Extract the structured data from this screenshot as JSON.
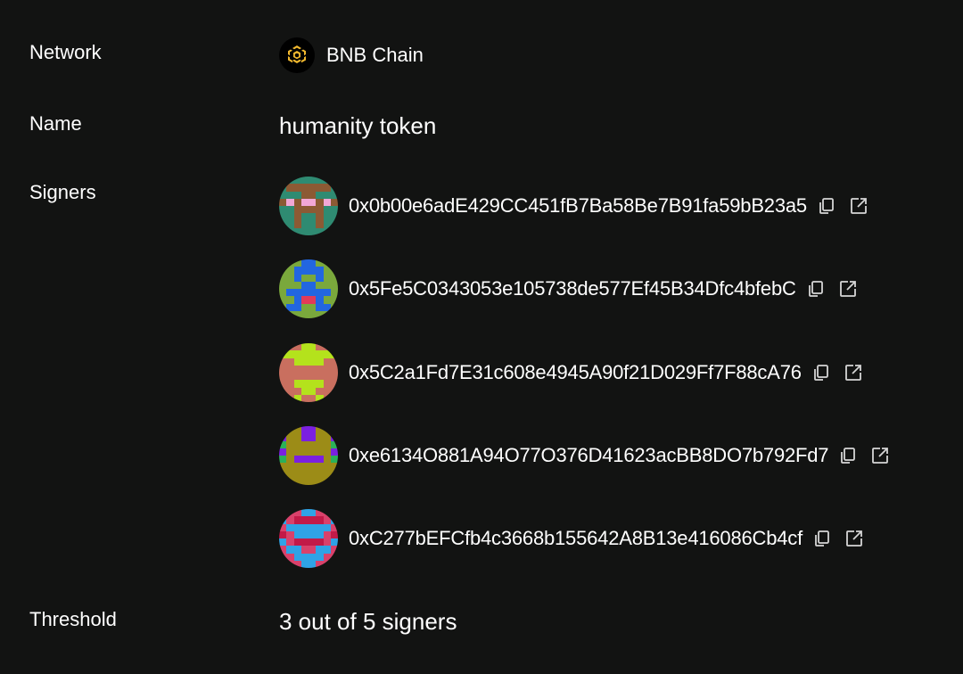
{
  "labels": {
    "network": "Network",
    "name": "Name",
    "signers": "Signers",
    "threshold": "Threshold"
  },
  "network": {
    "name": "BNB Chain",
    "icon": "bnb-chain-icon",
    "logo_color": "#F3BA2F"
  },
  "safe_name": "humanity token",
  "signers": [
    {
      "address": "0x0b00e6adE429CC451fB7Ba58Be7B91fa59bB23a5",
      "avatar_colors": [
        "#2f8b72",
        "#8c5a34",
        "#f2a7d6"
      ],
      "avatar_pattern": [
        "00000000",
        "01111110",
        "00011000",
        "12122121",
        "00111100",
        "00100100",
        "00100100",
        "00000000"
      ]
    },
    {
      "address": "0x5Fe5C0343053e105738de577Ef45B34Dfc4bfebC",
      "avatar_colors": [
        "#7aa83c",
        "#2266e0",
        "#e23a59"
      ],
      "avatar_pattern": [
        "00011000",
        "00111100",
        "00100100",
        "00011000",
        "01111110",
        "00122100",
        "01100110",
        "00000000"
      ]
    },
    {
      "address": "0x5C2a1Fd7E31c608e4945A90f21D029Ff7F88cA76",
      "avatar_colors": [
        "#c96f5f",
        "#b4e21c",
        "#d65a48"
      ],
      "avatar_pattern": [
        "00011000",
        "11111111",
        "00111100",
        "00000000",
        "00000000",
        "00111100",
        "00011000",
        "00100100"
      ]
    },
    {
      "address": "0xe6134O881A94O77O376D41623acBB8DO7b792Fd7",
      "avatar_colors": [
        "#9c8c17",
        "#7b20e0",
        "#2bb159"
      ],
      "avatar_pattern": [
        "00011000",
        "10011001",
        "20000002",
        "10000001",
        "20111102",
        "00000000",
        "00000000",
        "00000000"
      ]
    },
    {
      "address": "0xC277bEFCfb4c3668b155642A8B13e416086Cb4cf",
      "avatar_colors": [
        "#d9416b",
        "#2fa3e6",
        "#c21a48"
      ],
      "avatar_pattern": [
        "00011000",
        "10222201",
        "01111110",
        "20111102",
        "10222201",
        "01100110",
        "00111100",
        "00011000"
      ]
    }
  ],
  "threshold_text": "3 out of 5 signers",
  "icons": {
    "copy": "copy-icon",
    "external_link": "external-link-icon"
  }
}
